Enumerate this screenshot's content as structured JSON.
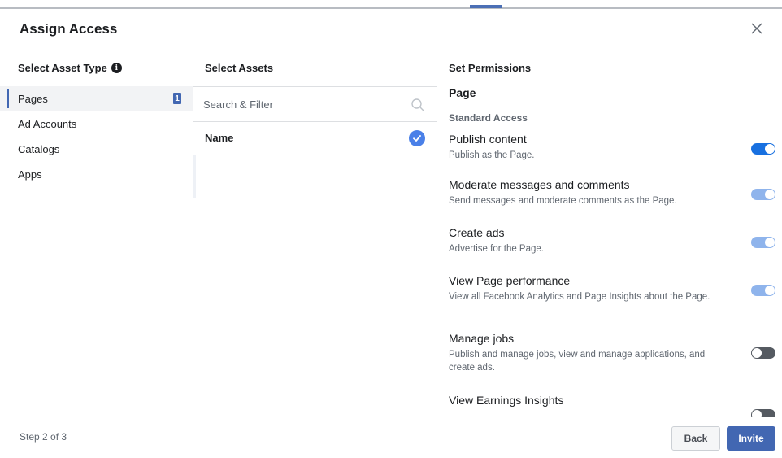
{
  "dialog": {
    "title": "Assign Access",
    "close_icon": "close-icon"
  },
  "asset_types": {
    "heading": "Select Asset Type",
    "info_icon": "i",
    "items": [
      {
        "label": "Pages",
        "selected": true,
        "count": "1"
      },
      {
        "label": "Ad Accounts",
        "selected": false
      },
      {
        "label": "Catalogs",
        "selected": false
      },
      {
        "label": "Apps",
        "selected": false
      }
    ]
  },
  "assets": {
    "heading": "Select Assets",
    "search_placeholder": "Search & Filter",
    "name_label": "Name",
    "name_checked": true
  },
  "permissions": {
    "heading": "Set Permissions",
    "page_label": "Page",
    "group_label": "Standard Access",
    "items": [
      {
        "title": "Publish content",
        "description": "Publish as the Page.",
        "state": "on"
      },
      {
        "title": "Moderate messages and comments",
        "description": "Send messages and moderate comments as the Page.",
        "state": "dim"
      },
      {
        "title": "Create ads",
        "description": "Advertise for the Page.",
        "state": "dim"
      },
      {
        "title": "View Page performance",
        "description": "View all Facebook Analytics and Page Insights about the Page.",
        "state": "dim"
      },
      {
        "title": "Manage jobs",
        "description": "Publish and manage jobs, view and manage applications, and create ads.",
        "state": "off"
      },
      {
        "title": "View Earnings Insights",
        "description": "",
        "state": "off"
      }
    ]
  },
  "footer": {
    "step": "Step 2 of 3",
    "back_label": "Back",
    "invite_label": "Invite"
  },
  "colors": {
    "primary": "#4267b2",
    "toggle_on": "#1870e0",
    "toggle_dim": "#8fb4ec",
    "toggle_off": "#555a61",
    "check": "#4a80e8"
  }
}
